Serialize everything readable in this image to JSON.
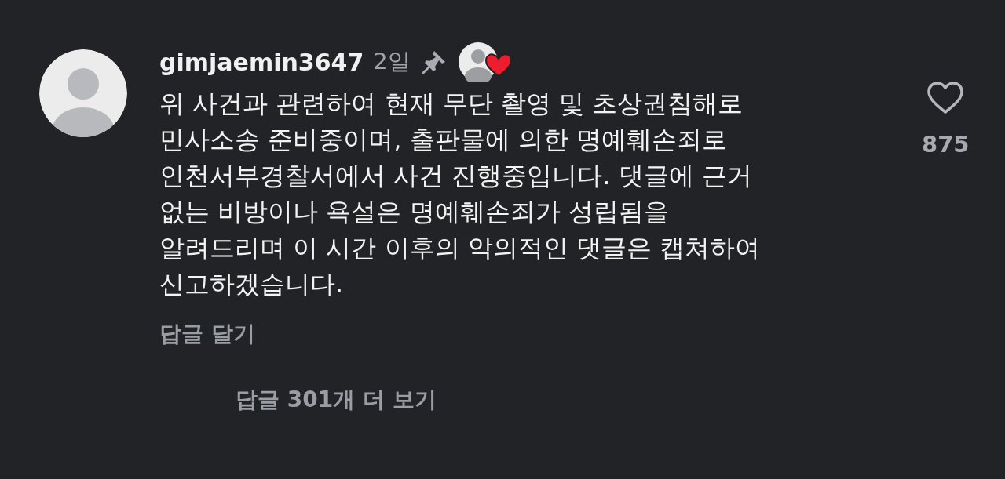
{
  "comment": {
    "username": "gimjaemin3647",
    "time": "2일",
    "pinned": true,
    "creator_liked": true,
    "body_lines": [
      "위 사건과 관련하여 현재 무단 촬영 및 초상권침해로",
      "민사소송 준비중이며, 출판물에 의한 명예훼손죄로",
      "인천서부경찰서에서 사건 진행중입니다. 댓글에 근거",
      "없는 비방이나 욕설은 명예훼손죄가 성립됨을",
      "알려드리며 이 시간 이후의 악의적인 댓글은 캡쳐하여",
      "신고하겠습니다."
    ],
    "reply_button": "답글 달기",
    "like_count": "875",
    "liked": false
  },
  "view_replies": "답글 301개 더 보기"
}
